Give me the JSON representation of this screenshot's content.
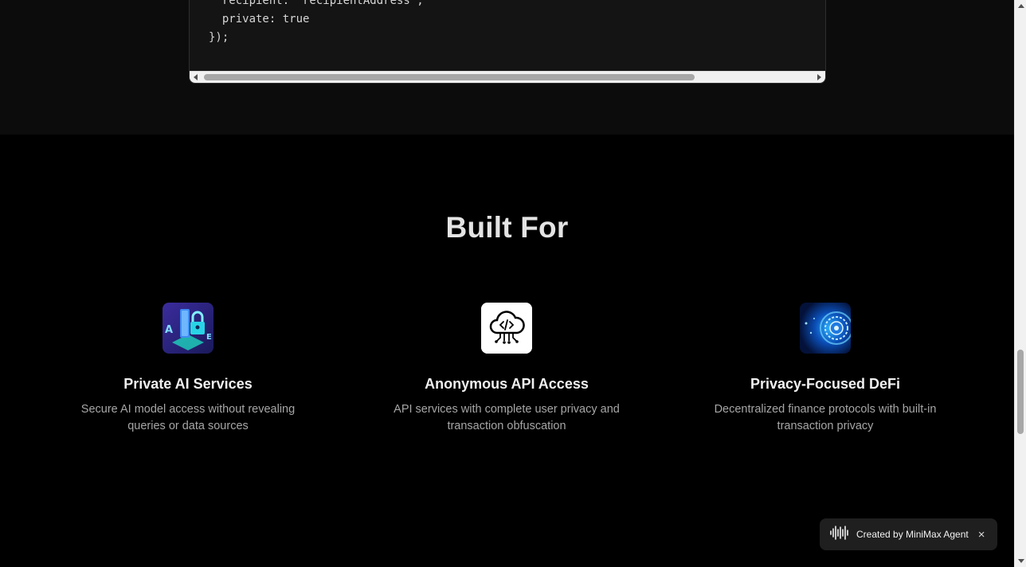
{
  "code_block": {
    "lines": [
      "  recipient: 'recipientAddress',",
      "  private: true",
      "});"
    ]
  },
  "built_for": {
    "title": "Built For",
    "cards": [
      {
        "icon": "ai-lock-icon",
        "title": "Private AI Services",
        "description": "Secure AI model access without revealing queries or data sources"
      },
      {
        "icon": "cloud-code-icon",
        "title": "Anonymous API Access",
        "description": "API services with complete user privacy and transaction obfuscation"
      },
      {
        "icon": "defi-privacy-icon",
        "title": "Privacy-Focused DeFi",
        "description": "Decentralized finance protocols with built-in transaction privacy"
      }
    ]
  },
  "badge": {
    "icon": "waveform-icon",
    "text": "Created by MiniMax Agent",
    "close_label": "×"
  },
  "colors": {
    "page_background": "#000000",
    "code_section_background": "#0c0c0c",
    "code_block_background": "#141414",
    "badge_background": "#1f1f1f"
  }
}
